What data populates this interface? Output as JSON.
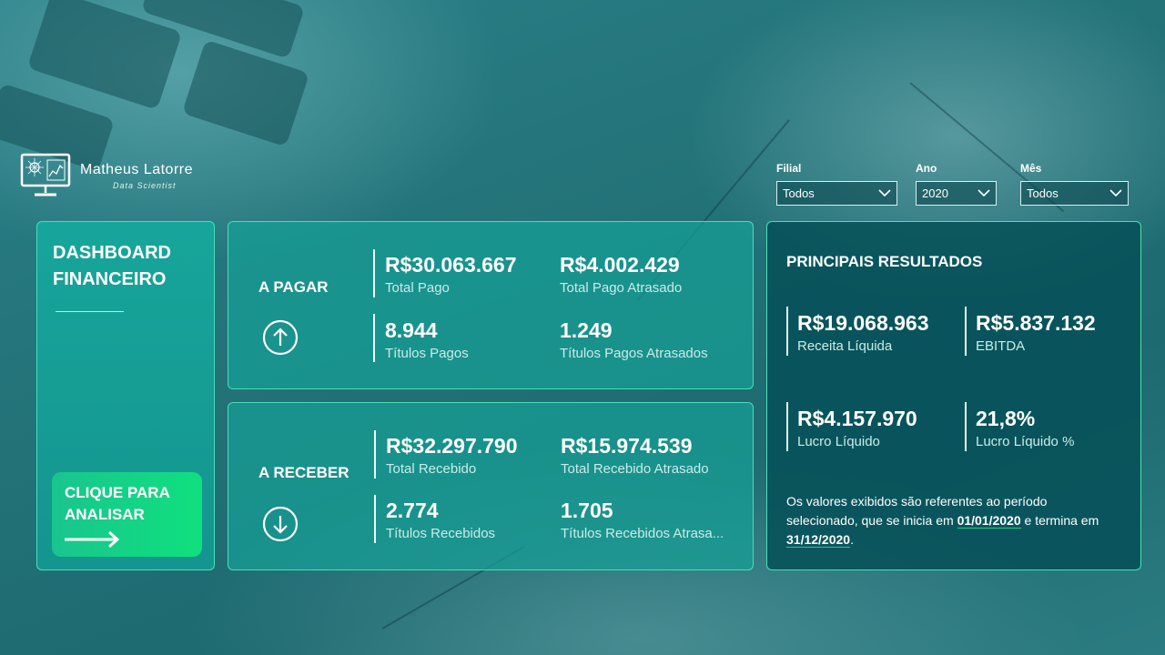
{
  "brand": {
    "name": "Matheus Latorre",
    "role": "Data Scientist"
  },
  "filters": [
    {
      "label": "Filial",
      "value": "Todos"
    },
    {
      "label": "Ano",
      "value": "2020"
    },
    {
      "label": "Mês",
      "value": "Todos"
    }
  ],
  "sidebar": {
    "title_line1": "DASHBOARD",
    "title_line2": "FINANCEIRO",
    "cta_line1": "CLIQUE PARA",
    "cta_line2": "ANALISAR"
  },
  "payables": {
    "label": "A PAGAR",
    "icon": "arrow-up-circle-icon",
    "metrics": [
      {
        "value": "R$30.063.667",
        "label": "Total Pago"
      },
      {
        "value": "R$4.002.429",
        "label": "Total Pago Atrasado"
      },
      {
        "value": "8.944",
        "label": "Títulos Pagos"
      },
      {
        "value": "1.249",
        "label": "Títulos Pagos Atrasados"
      }
    ]
  },
  "receivables": {
    "label": "A RECEBER",
    "icon": "arrow-down-circle-icon",
    "metrics": [
      {
        "value": "R$32.297.790",
        "label": "Total Recebido"
      },
      {
        "value": "R$15.974.539",
        "label": "Total Recebido Atrasado"
      },
      {
        "value": "2.774",
        "label": "Títulos Recebidos"
      },
      {
        "value": "1.705",
        "label": "Títulos Recebidos Atrasa..."
      }
    ]
  },
  "results": {
    "title": "PRINCIPAIS RESULTADOS",
    "metrics": [
      {
        "value": "R$19.068.963",
        "label": "Receita Líquida"
      },
      {
        "value": "R$5.837.132",
        "label": "EBITDA"
      },
      {
        "value": "R$4.157.970",
        "label": "Lucro Líquido"
      },
      {
        "value": "21,8%",
        "label": "Lucro Líquido %"
      }
    ],
    "note_part1": "Os valores exibidos são referentes ao período selecionado, que se inicia em ",
    "start_date": "01/01/2020",
    "note_part2": " e termina em ",
    "end_date": "31/12/2020",
    "note_part3": "."
  },
  "colors": {
    "accent": "#48e0b4",
    "cta": "#0fe07e",
    "card_teal": "#16a096",
    "card_dark": "#065058"
  }
}
